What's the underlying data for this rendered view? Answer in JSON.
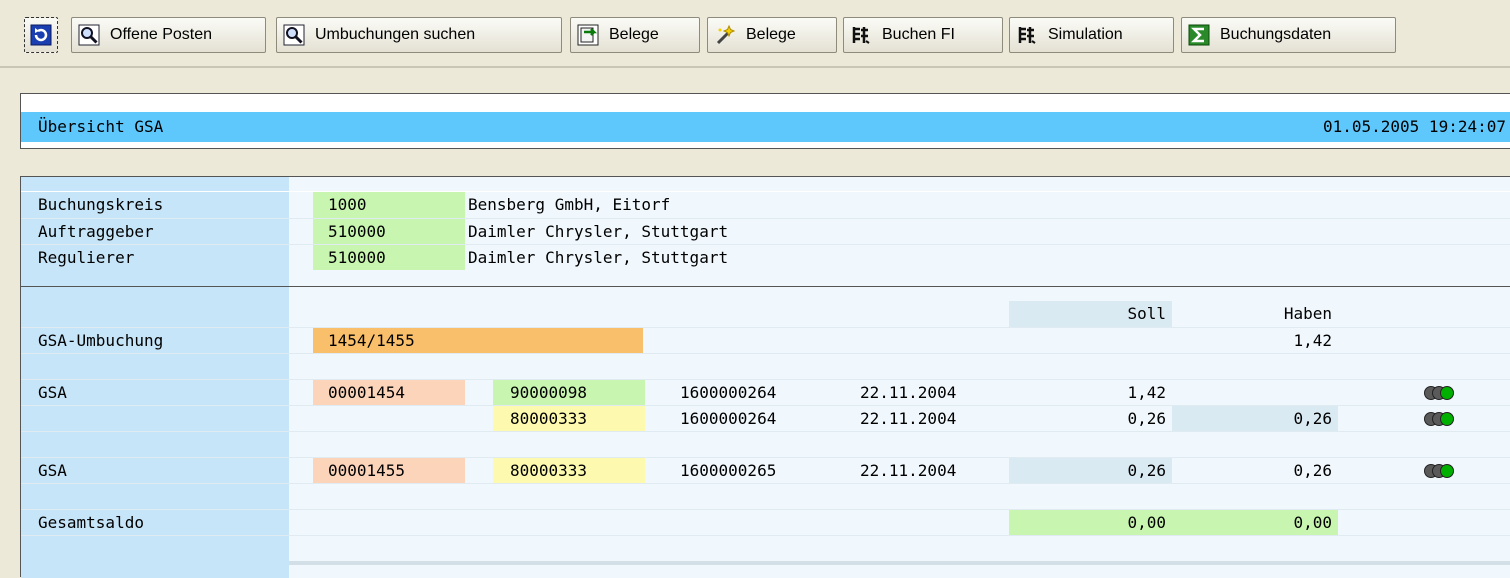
{
  "toolbar": {
    "b0": "",
    "b1": "Offene Posten",
    "b2": "Umbuchungen suchen",
    "b3": "Belege",
    "b4": "Belege",
    "b5": "Buchen FI",
    "b6": "Simulation",
    "b7": "Buchungsdaten"
  },
  "header": {
    "title": "Übersicht GSA",
    "datetime": "01.05.2005 19:24:07"
  },
  "info": [
    {
      "label": "Buchungskreis",
      "code": "1000",
      "name": "Bensberg GmbH, Eitorf"
    },
    {
      "label": "Auftraggeber",
      "code": "510000",
      "name": "Daimler Chrysler, Stuttgart"
    },
    {
      "label": "Regulierer",
      "code": "510000",
      "name": "Daimler Chrysler, Stuttgart"
    }
  ],
  "columns": {
    "soll": "Soll",
    "haben": "Haben"
  },
  "umbuchung": {
    "label": "GSA-Umbuchung",
    "value": "1454/1455",
    "haben": "1,42"
  },
  "gsa1": {
    "label": "GSA",
    "nr": "00001454",
    "rows": [
      {
        "beleg": "90000098",
        "ref": "1600000264",
        "datum": "22.11.2004",
        "soll": "1,42",
        "haben": ""
      },
      {
        "beleg": "80000333",
        "ref": "1600000264",
        "datum": "22.11.2004",
        "soll": "0,26",
        "haben": "0,26"
      }
    ]
  },
  "gsa2": {
    "label": "GSA",
    "nr": "00001455",
    "row": {
      "beleg": "80000333",
      "ref": "1600000265",
      "datum": "22.11.2004",
      "soll": "0,26",
      "haben": "0,26"
    }
  },
  "total": {
    "label": "Gesamtsaldo",
    "soll": "0,00",
    "haben": "0,00"
  },
  "colors": {
    "status": "#00b000",
    "lightOff": "#5a5a5a"
  }
}
